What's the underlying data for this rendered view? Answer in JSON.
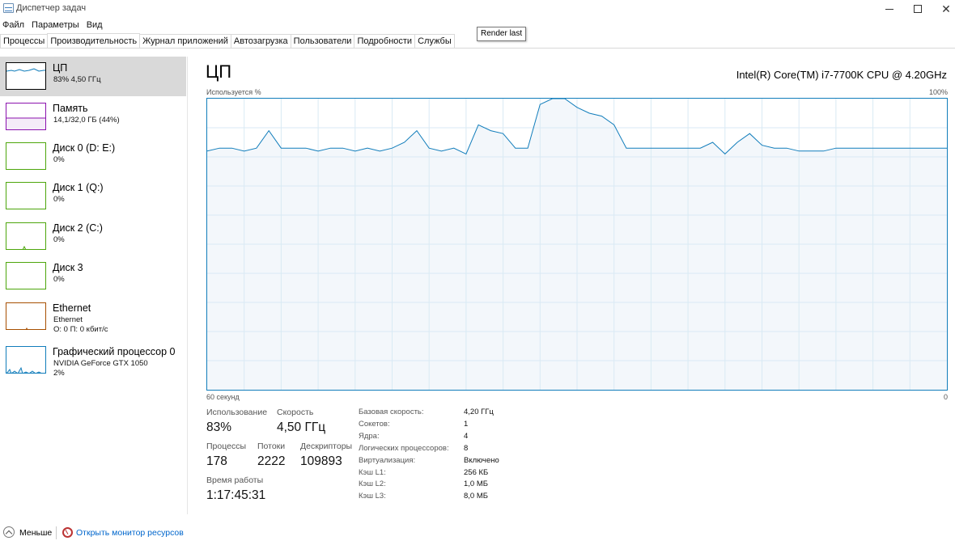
{
  "window": {
    "title": "Диспетчер задач",
    "tooltip": "Render last"
  },
  "menu": [
    "Файл",
    "Параметры",
    "Вид"
  ],
  "tabs": [
    "Процессы",
    "Производительность",
    "Журнал приложений",
    "Автозагрузка",
    "Пользователи",
    "Подробности",
    "Службы"
  ],
  "active_tab": "Производительность",
  "sidebar": {
    "items": [
      {
        "title": "ЦП",
        "sub1": "83% 4,50 ГГц",
        "sub2": "",
        "color": "#117dbb",
        "selected": true
      },
      {
        "title": "Память",
        "sub1": "14,1/32,0 ГБ (44%)",
        "sub2": "",
        "color": "#8b12ae",
        "selected": false
      },
      {
        "title": "Диск 0 (D: E:)",
        "sub1": "0%",
        "sub2": "",
        "color": "#4da60c",
        "selected": false
      },
      {
        "title": "Диск 1 (Q:)",
        "sub1": "0%",
        "sub2": "",
        "color": "#4da60c",
        "selected": false
      },
      {
        "title": "Диск 2 (C:)",
        "sub1": "0%",
        "sub2": "",
        "color": "#4da60c",
        "selected": false
      },
      {
        "title": "Диск 3",
        "sub1": "0%",
        "sub2": "",
        "color": "#4da60c",
        "selected": false
      },
      {
        "title": "Ethernet",
        "sub1": "Ethernet",
        "sub2": "О: 0 П: 0 кбит/с",
        "color": "#a74f01",
        "selected": false
      },
      {
        "title": "Графический процессор 0",
        "sub1": "NVIDIA GeForce GTX 1050",
        "sub2": "2%",
        "color": "#117dbb",
        "selected": false
      }
    ]
  },
  "main": {
    "title": "ЦП",
    "cpu_name": "Intel(R) Core(TM) i7-7700K CPU @ 4.20GHz",
    "chart_top_left": "Используется %",
    "chart_top_right": "100%",
    "chart_bottom_left": "60 секунд",
    "chart_bottom_right": "0"
  },
  "chart_data": {
    "type": "area",
    "color": "#117dbb",
    "fill": "#f1f6fa",
    "ylim": [
      0,
      100
    ],
    "grid": true,
    "x": [
      60,
      59,
      58,
      57,
      56,
      55,
      54,
      53,
      52,
      51,
      50,
      49,
      48,
      47,
      46,
      45,
      44,
      43,
      42,
      41,
      40,
      39,
      38,
      37,
      36,
      35,
      34,
      33,
      32,
      31,
      30,
      29,
      28,
      27,
      26,
      25,
      24,
      23,
      22,
      21,
      20,
      19,
      18,
      17,
      16,
      15,
      14,
      13,
      12,
      11,
      10,
      9,
      8,
      7,
      6,
      5,
      4,
      3,
      2,
      1,
      0
    ],
    "values": [
      82,
      83,
      83,
      82,
      83,
      89,
      83,
      83,
      83,
      82,
      83,
      83,
      82,
      83,
      82,
      83,
      85,
      89,
      83,
      82,
      83,
      81,
      91,
      89,
      88,
      83,
      83,
      98,
      100,
      100,
      97,
      95,
      94,
      91,
      83,
      83,
      83,
      83,
      83,
      83,
      83,
      85,
      81,
      85,
      88,
      84,
      83,
      83,
      82,
      82,
      82,
      83,
      83,
      83,
      83,
      83,
      83,
      83,
      83,
      83,
      83
    ]
  },
  "stats": {
    "usage_label": "Использование",
    "usage_value": "83%",
    "speed_label": "Скорость",
    "speed_value": "4,50 ГГц",
    "processes_label": "Процессы",
    "processes_value": "178",
    "threads_label": "Потоки",
    "threads_value": "2222",
    "handles_label": "Дескрипторы",
    "handles_value": "109893",
    "uptime_label": "Время работы",
    "uptime_value": "1:17:45:31"
  },
  "info": [
    {
      "label": "Базовая скорость:",
      "value": "4,20 ГГц"
    },
    {
      "label": "Сокетов:",
      "value": "1"
    },
    {
      "label": "Ядра:",
      "value": "4"
    },
    {
      "label": "Логических процессоров:",
      "value": "8"
    },
    {
      "label": "Виртуализация:",
      "value": "Включено"
    },
    {
      "label": "Кэш L1:",
      "value": "256 КБ"
    },
    {
      "label": "Кэш L2:",
      "value": "1,0 МБ"
    },
    {
      "label": "Кэш L3:",
      "value": "8,0 МБ"
    }
  ],
  "footer": {
    "less_label": "Меньше",
    "monitor_label": "Открыть монитор ресурсов"
  }
}
